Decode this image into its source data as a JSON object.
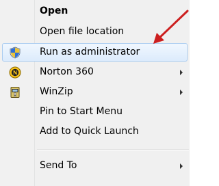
{
  "context_menu": {
    "items": [
      {
        "label": "Open",
        "bold": true
      },
      {
        "label": "Open file location"
      },
      {
        "label": "Run as administrator",
        "icon": "uac-shield-icon",
        "highlighted": true
      },
      {
        "label": "Norton 360",
        "icon": "norton-icon",
        "submenu": true
      },
      {
        "label": "WinZip",
        "icon": "winzip-icon",
        "submenu": true
      },
      {
        "label": "Pin to Start Menu"
      },
      {
        "label": "Add to Quick Launch"
      },
      {
        "label": "Send To",
        "submenu": true
      }
    ]
  },
  "annotation": {
    "icon": "red-arrow-icon",
    "color": "#cc1f1f"
  },
  "colors": {
    "highlight_border": "#aaccf0",
    "menu_background": "#f0f0f0"
  }
}
